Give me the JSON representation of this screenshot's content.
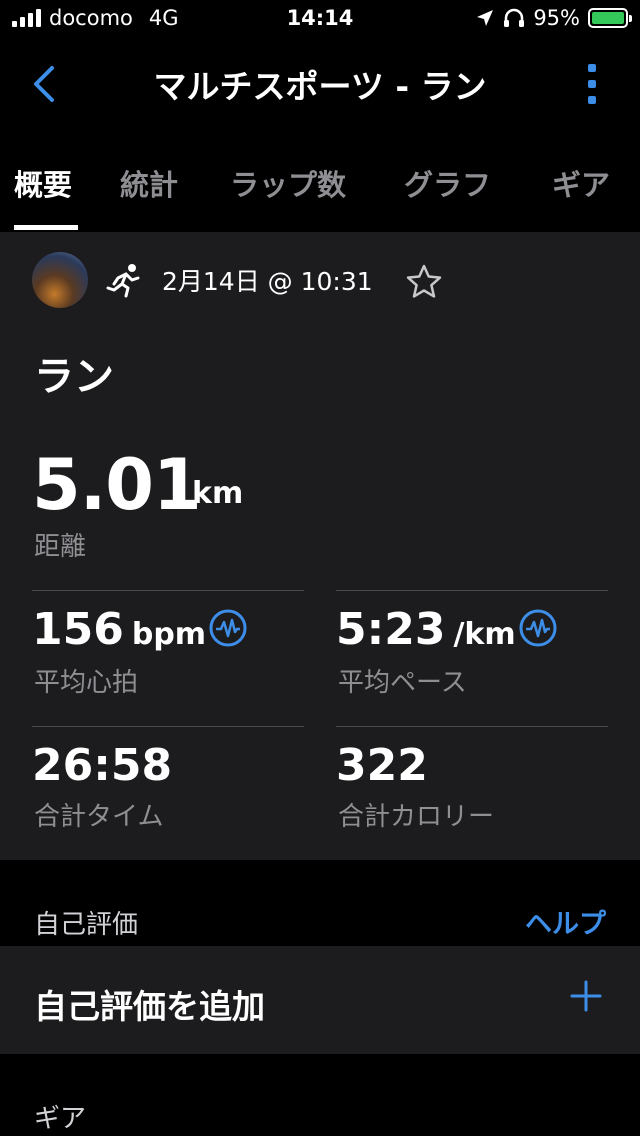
{
  "status_bar": {
    "carrier": "docomo",
    "network": "4G",
    "time": "14:14",
    "battery": "95%"
  },
  "nav": {
    "title": "マルチスポーツ - ラン",
    "back_icon": "chevron-left-icon",
    "more_icon": "more-vertical-icon"
  },
  "tabs": [
    "概要",
    "統計",
    "ラップ数",
    "グラフ",
    "ギア"
  ],
  "activity": {
    "datetime": "2月14日 @ 10:31",
    "name": "ラン",
    "distance": {
      "value": "5.01",
      "unit": "km",
      "label": "距離"
    },
    "avg_hr": {
      "value": "156",
      "unit": "bpm",
      "label": "平均心拍"
    },
    "avg_pace": {
      "value": "5:23",
      "unit": "/km",
      "label": "平均ペース"
    },
    "total_time": {
      "value": "26:58",
      "label": "合計タイム"
    },
    "total_calories": {
      "value": "322",
      "label": "合計カロリー"
    }
  },
  "self_eval": {
    "section_label": "自己評価",
    "help": "ヘルプ",
    "add_label": "自己評価を追加"
  },
  "next_section_label": "ギア",
  "colors": {
    "accent": "#3d8ee8",
    "card": "#1c1c1e",
    "background": "#000000",
    "secondary_text": "#8e8e93"
  }
}
